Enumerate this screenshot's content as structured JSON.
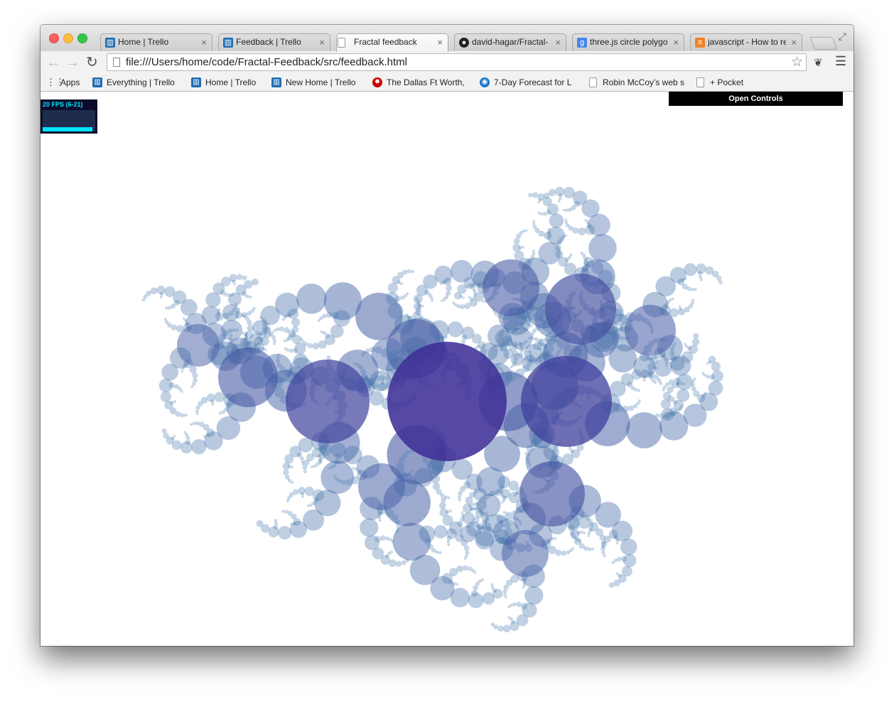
{
  "browser": {
    "tabs": [
      {
        "label": "Home | Trello",
        "icon": "trello-icon",
        "active": false
      },
      {
        "label": "Feedback | Trello",
        "icon": "trello-icon",
        "active": false
      },
      {
        "label": "Fractal feedback",
        "icon": "page-icon",
        "active": true
      },
      {
        "label": "david-hagar/Fractal-",
        "icon": "github-icon",
        "active": false
      },
      {
        "label": "three.js circle polygo",
        "icon": "google-icon",
        "active": false
      },
      {
        "label": "javascript - How to re",
        "icon": "stackoverflow-icon",
        "active": false
      }
    ],
    "close_glyph": "×",
    "url": "file:///Users/home/code/Fractal-Feedback/src/feedback.html",
    "bookmarks": [
      {
        "label": "Apps",
        "icon": "apps-grid-icon"
      },
      {
        "label": "Everything | Trello",
        "icon": "trello-icon"
      },
      {
        "label": "Home | Trello",
        "icon": "trello-icon"
      },
      {
        "label": "New Home | Trello",
        "icon": "trello-icon"
      },
      {
        "label": "The Dallas Ft Worth,",
        "icon": "radar-icon"
      },
      {
        "label": "7-Day Forecast for L",
        "icon": "noaa-icon"
      },
      {
        "label": "Robin McCoy's web s",
        "icon": "page-icon"
      },
      {
        "label": "+ Pocket",
        "icon": "page-icon"
      }
    ]
  },
  "page": {
    "fps_text": "20 FPS (6-21)",
    "fps_fill": 0.95,
    "controls_label": "Open Controls"
  },
  "colors": {
    "fractal_small": "#4a7fb0",
    "fractal_large": "#3f3097"
  }
}
